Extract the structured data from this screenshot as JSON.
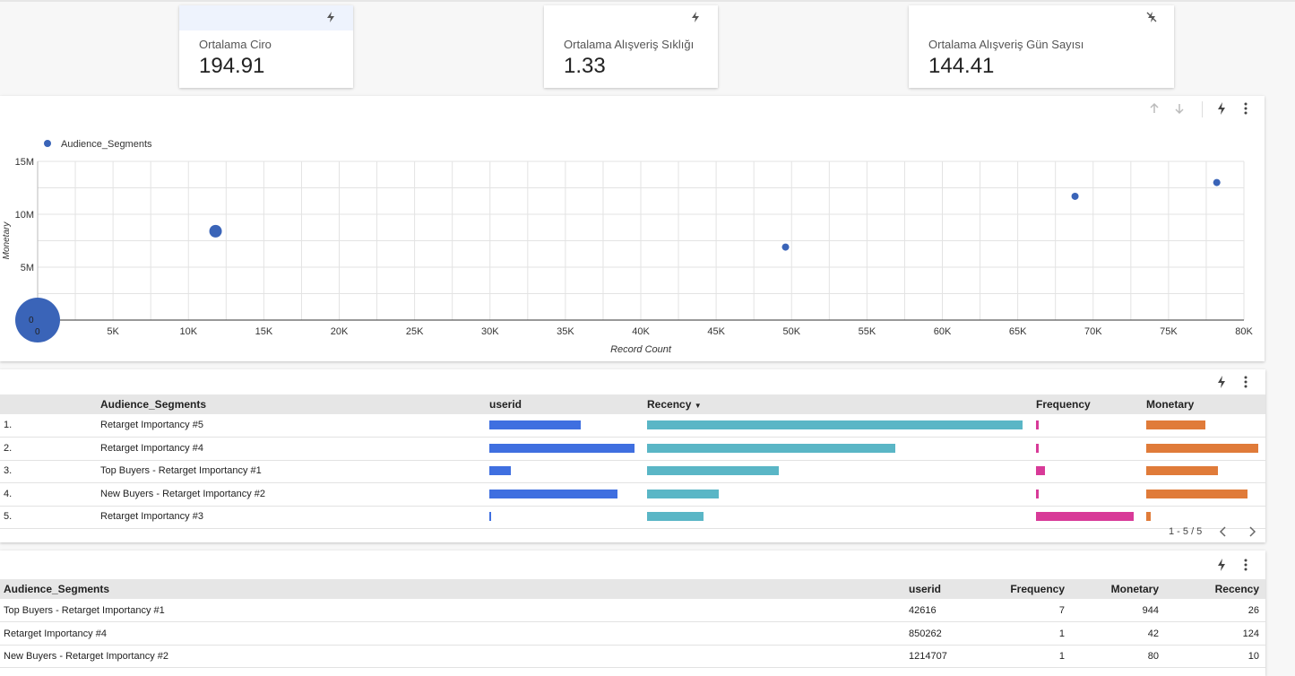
{
  "kpis": [
    {
      "label": "Ortalama Ciro",
      "value": "194.91",
      "icon": "bolt-icon"
    },
    {
      "label": "Ortalama Alışveriş Sıklığı",
      "value": "1.33",
      "icon": "bolt-icon"
    },
    {
      "label": "Ortalama Alışveriş Gün Sayısı",
      "value": "144.41",
      "icon": "bolt-off-icon"
    }
  ],
  "scatter": {
    "legend": "Audience_Segments",
    "xlabel": "Record Count",
    "ylabel": "Monetary",
    "origin_label": "0"
  },
  "chart_data": {
    "type": "scatter",
    "title": "",
    "xlabel": "Record Count",
    "ylabel": "Monetary",
    "xlim": [
      0,
      80000
    ],
    "ylim": [
      0,
      15000000
    ],
    "x_ticks": [
      "0",
      "5K",
      "10K",
      "15K",
      "20K",
      "25K",
      "30K",
      "35K",
      "40K",
      "45K",
      "50K",
      "55K",
      "60K",
      "65K",
      "70K",
      "75K",
      "80K"
    ],
    "y_ticks": [
      "5M",
      "10M",
      "15M"
    ],
    "legend": "top-left",
    "grid": true,
    "series": [
      {
        "name": "Audience_Segments",
        "color": "#3a64b8",
        "points": [
          {
            "x": 0,
            "y": 0,
            "size": "large"
          },
          {
            "x": 11800,
            "y": 8400000,
            "size": "medium"
          },
          {
            "x": 49600,
            "y": 6900000,
            "size": "small"
          },
          {
            "x": 68800,
            "y": 11700000,
            "size": "small"
          },
          {
            "x": 78200,
            "y": 13000000,
            "size": "small"
          }
        ]
      }
    ]
  },
  "bar_table": {
    "headers": {
      "segment": "Audience_Segments",
      "userid": "userid",
      "recency": "Recency",
      "frequency": "Frequency",
      "monetary": "Monetary"
    },
    "rows": [
      {
        "idx": "1.",
        "segment": "Retarget Importancy #5",
        "userid": 0.63,
        "recency": 1.0,
        "frequency": 0.03,
        "monetary": 0.53
      },
      {
        "idx": "2.",
        "segment": "Retarget Importancy #4",
        "userid": 1.0,
        "recency": 0.66,
        "frequency": 0.03,
        "monetary": 1.0
      },
      {
        "idx": "3.",
        "segment": "Top Buyers - Retarget Importancy #1",
        "userid": 0.15,
        "recency": 0.35,
        "frequency": 0.09,
        "monetary": 0.64
      },
      {
        "idx": "4.",
        "segment": "New Buyers - Retarget Importancy #2",
        "userid": 0.88,
        "recency": 0.19,
        "frequency": 0.03,
        "monetary": 0.9
      },
      {
        "idx": "5.",
        "segment": "Retarget Importancy #3",
        "userid": 0.01,
        "recency": 0.15,
        "frequency": 1.0,
        "monetary": 0.04
      }
    ],
    "pagination": "1 - 5 / 5",
    "colors": {
      "userid": "#3f6fe0",
      "recency": "#5ab6c6",
      "frequency": "#d83a98",
      "monetary": "#e07b39"
    }
  },
  "data_table": {
    "headers": {
      "segment": "Audience_Segments",
      "userid": "userid",
      "frequency": "Frequency",
      "monetary": "Monetary",
      "recency": "Recency"
    },
    "rows": [
      {
        "segment": "Top Buyers - Retarget Importancy #1",
        "userid": "42616",
        "frequency": "7",
        "monetary": "944",
        "recency": "26"
      },
      {
        "segment": "Retarget Importancy #4",
        "userid": "850262",
        "frequency": "1",
        "monetary": "42",
        "recency": "124"
      },
      {
        "segment": "New Buyers - Retarget Importancy #2",
        "userid": "1214707",
        "frequency": "1",
        "monetary": "80",
        "recency": "10"
      }
    ]
  }
}
